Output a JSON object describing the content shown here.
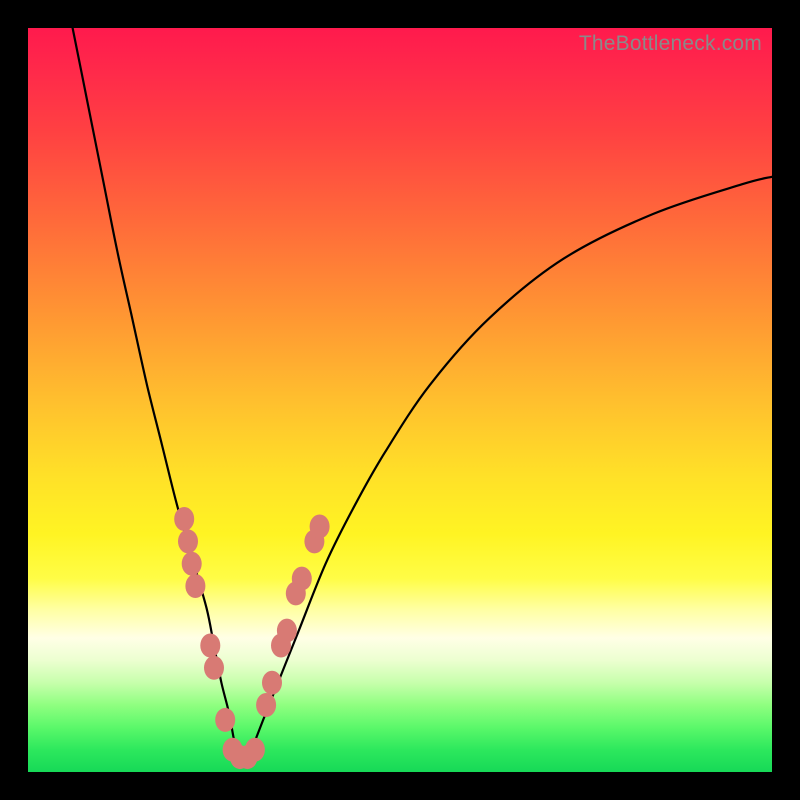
{
  "watermark": "TheBottleneck.com",
  "colors": {
    "frame": "#000000",
    "marker": "#d87a74",
    "curve": "#000000",
    "gradient_stops": [
      "#ff1a4d",
      "#ff6a3a",
      "#ffbf2e",
      "#fff423",
      "#ffffe6",
      "#17d957"
    ]
  },
  "chart_data": {
    "type": "line",
    "title": "",
    "xlabel": "",
    "ylabel": "",
    "xlim": [
      0,
      100
    ],
    "ylim": [
      0,
      100
    ],
    "grid": false,
    "legend": false,
    "series": [
      {
        "name": "bottleneck-curve",
        "x": [
          6,
          8,
          10,
          12,
          14,
          16,
          18,
          20,
          22,
          24,
          25,
          26,
          27,
          28,
          29,
          30,
          32,
          36,
          40,
          44,
          48,
          54,
          62,
          72,
          84,
          96,
          100
        ],
        "y": [
          100,
          90,
          80,
          70,
          61,
          52,
          44,
          36,
          29,
          22,
          17,
          12,
          8,
          3,
          2,
          3,
          8,
          18,
          28,
          36,
          43,
          52,
          61,
          69,
          75,
          79,
          80
        ]
      }
    ],
    "markers": {
      "name": "highlighted-points",
      "comment": "pink dots near the valley on both arms",
      "points": [
        {
          "x": 21.0,
          "y": 34
        },
        {
          "x": 21.5,
          "y": 31
        },
        {
          "x": 22.0,
          "y": 28
        },
        {
          "x": 22.5,
          "y": 25
        },
        {
          "x": 24.5,
          "y": 17
        },
        {
          "x": 25.0,
          "y": 14
        },
        {
          "x": 26.5,
          "y": 7
        },
        {
          "x": 27.5,
          "y": 3
        },
        {
          "x": 28.5,
          "y": 2
        },
        {
          "x": 29.5,
          "y": 2
        },
        {
          "x": 30.5,
          "y": 3
        },
        {
          "x": 32.0,
          "y": 9
        },
        {
          "x": 32.8,
          "y": 12
        },
        {
          "x": 34.0,
          "y": 17
        },
        {
          "x": 34.8,
          "y": 19
        },
        {
          "x": 36.0,
          "y": 24
        },
        {
          "x": 36.8,
          "y": 26
        },
        {
          "x": 38.5,
          "y": 31
        },
        {
          "x": 39.2,
          "y": 33
        }
      ]
    }
  }
}
